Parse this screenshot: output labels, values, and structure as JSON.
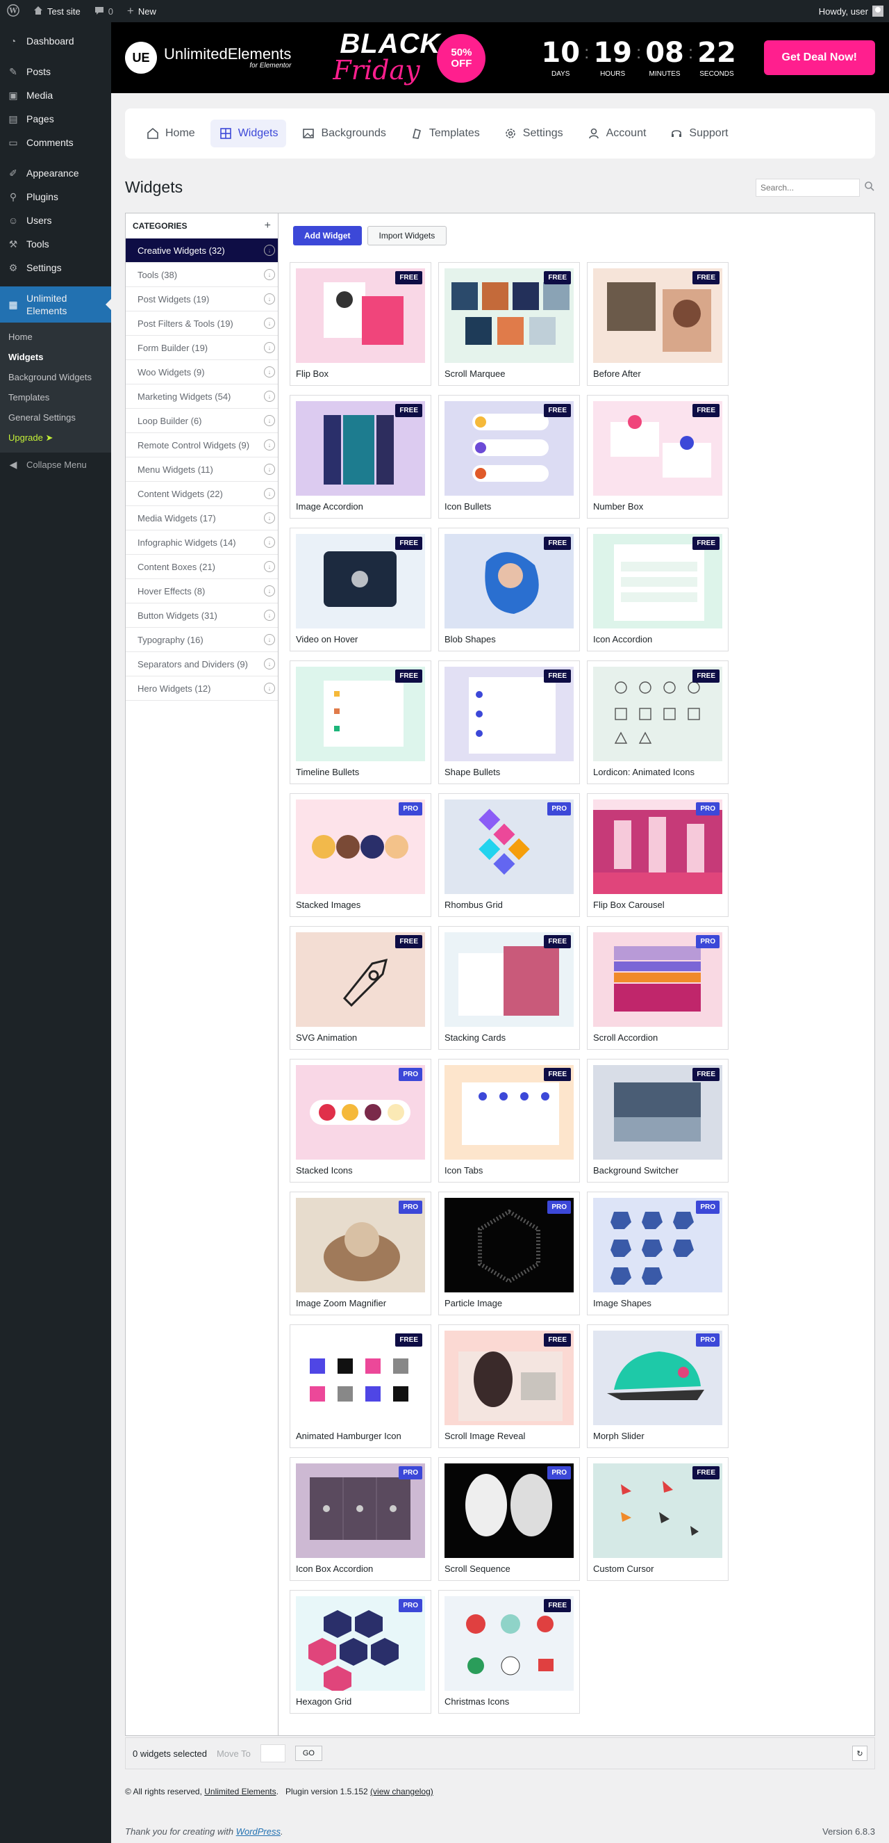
{
  "adminbar": {
    "site_name": "Test site",
    "comments_count": "0",
    "new_label": "New",
    "howdy": "Howdy, user"
  },
  "sidebar": {
    "items": [
      {
        "label": "Dashboard",
        "icon": "dashboard-icon"
      },
      {
        "label": "Posts",
        "icon": "pin-icon"
      },
      {
        "label": "Media",
        "icon": "media-icon"
      },
      {
        "label": "Pages",
        "icon": "pages-icon"
      },
      {
        "label": "Comments",
        "icon": "comment-icon"
      },
      {
        "label": "Appearance",
        "icon": "brush-icon"
      },
      {
        "label": "Plugins",
        "icon": "plugin-icon"
      },
      {
        "label": "Users",
        "icon": "user-icon"
      },
      {
        "label": "Tools",
        "icon": "wrench-icon"
      },
      {
        "label": "Settings",
        "icon": "settings-icon"
      }
    ],
    "active": {
      "label": "Unlimited Elements",
      "icon": "ue-icon"
    },
    "submenu": [
      "Home",
      "Widgets",
      "Background Widgets",
      "Templates",
      "General Settings",
      "Upgrade ➤"
    ],
    "collapse": "Collapse Menu"
  },
  "banner": {
    "logo_mark": "UE",
    "logo_text": "UnlimitedElements",
    "logo_sub": "for Elementor",
    "black": "BLACK",
    "friday": "Friday",
    "off_pct": "50%",
    "off_label": "OFF",
    "timer": [
      {
        "value": "10",
        "label": "DAYS"
      },
      {
        "value": "19",
        "label": "HOURS"
      },
      {
        "value": "08",
        "label": "MINUTES"
      },
      {
        "value": "22",
        "label": "SECONDS"
      }
    ],
    "cta": "Get Deal Now!"
  },
  "nav": [
    "Home",
    "Widgets",
    "Backgrounds",
    "Templates",
    "Settings",
    "Account",
    "Support"
  ],
  "page_title": "Widgets",
  "search_placeholder": "Search...",
  "categories_title": "CATEGORIES",
  "categories": [
    "Creative Widgets (32)",
    "Tools (38)",
    "Post Widgets (19)",
    "Post Filters & Tools (19)",
    "Form Builder (19)",
    "Woo Widgets (9)",
    "Marketing Widgets (54)",
    "Loop Builder (6)",
    "Remote Control Widgets (9)",
    "Menu Widgets (11)",
    "Content Widgets (22)",
    "Media Widgets (17)",
    "Infographic Widgets (14)",
    "Content Boxes (21)",
    "Hover Effects (8)",
    "Button Widgets (31)",
    "Typography (16)",
    "Separators and Dividers (9)",
    "Hero Widgets (12)"
  ],
  "buttons": {
    "add": "Add Widget",
    "import": "Import Widgets"
  },
  "widgets": [
    {
      "name": "Flip Box",
      "badge": "FREE",
      "bg": "#f9d7e6"
    },
    {
      "name": "Scroll Marquee",
      "badge": "FREE",
      "bg": "#e5f3ec"
    },
    {
      "name": "Before After",
      "badge": "FREE",
      "bg": "#f6e4d9"
    },
    {
      "name": "Image Accordion",
      "badge": "FREE",
      "bg": "#dccbf0"
    },
    {
      "name": "Icon Bullets",
      "badge": "FREE",
      "bg": "#dcdcf3"
    },
    {
      "name": "Number Box",
      "badge": "FREE",
      "bg": "#fbe3ee"
    },
    {
      "name": "Video on Hover",
      "badge": "FREE",
      "bg": "#eaf1f8"
    },
    {
      "name": "Blob Shapes",
      "badge": "FREE",
      "bg": "#dbe3f4"
    },
    {
      "name": "Icon Accordion",
      "badge": "FREE",
      "bg": "#ddf4ea"
    },
    {
      "name": "Timeline Bullets",
      "badge": "FREE",
      "bg": "#ddf5ec"
    },
    {
      "name": "Shape Bullets",
      "badge": "FREE",
      "bg": "#e2e0f4"
    },
    {
      "name": "Lordicon: Animated Icons",
      "badge": "FREE",
      "bg": "#e7f1ec"
    },
    {
      "name": "Stacked Images",
      "badge": "PRO",
      "bg": "#fde3ea"
    },
    {
      "name": "Rhombus Grid",
      "badge": "PRO",
      "bg": "#dfe6f1"
    },
    {
      "name": "Flip Box Carousel",
      "badge": "PRO",
      "bg": "#fbe0ea"
    },
    {
      "name": "SVG Animation",
      "badge": "FREE",
      "bg": "#f3ddd3"
    },
    {
      "name": "Stacking Cards",
      "badge": "FREE",
      "bg": "#ebf3f7"
    },
    {
      "name": "Scroll Accordion",
      "badge": "PRO",
      "bg": "#f9d9e3"
    },
    {
      "name": "Stacked Icons",
      "badge": "PRO",
      "bg": "#f9d7e6"
    },
    {
      "name": "Icon Tabs",
      "badge": "FREE",
      "bg": "#fde5cc"
    },
    {
      "name": "Background Switcher",
      "badge": "FREE",
      "bg": "#d8dde7"
    },
    {
      "name": "Image Zoom Magnifier",
      "badge": "PRO",
      "bg": "#e7dccd"
    },
    {
      "name": "Particle Image",
      "badge": "PRO",
      "bg": "#050505"
    },
    {
      "name": "Image Shapes",
      "badge": "PRO",
      "bg": "#dde4f7"
    },
    {
      "name": "Animated Hamburger Icon",
      "badge": "FREE",
      "bg": "#ffffff"
    },
    {
      "name": "Scroll Image Reveal",
      "badge": "FREE",
      "bg": "#fbd9d3"
    },
    {
      "name": "Morph Slider",
      "badge": "PRO",
      "bg": "#e1e6f1"
    },
    {
      "name": "Icon Box Accordion",
      "badge": "PRO",
      "bg": "#cdb9d3"
    },
    {
      "name": "Scroll Sequence",
      "badge": "PRO",
      "bg": "#050505"
    },
    {
      "name": "Custom Cursor",
      "badge": "FREE",
      "bg": "#d5e9e6"
    },
    {
      "name": "Hexagon Grid",
      "badge": "PRO",
      "bg": "#e8f7f9"
    },
    {
      "name": "Christmas Icons",
      "badge": "FREE",
      "bg": "#eef3f8"
    }
  ],
  "footer": {
    "selected": "0 widgets selected",
    "move_to": "Move To",
    "go": "GO",
    "copyright": "© All rights reserved,",
    "company": "Unlimited Elements",
    "plugin_version": "Plugin version 1.5.152",
    "changelog": "(view changelog)",
    "thanks_prefix": "Thank you for creating with",
    "wordpress": "WordPress",
    "wp_version": "Version 6.8.3"
  }
}
